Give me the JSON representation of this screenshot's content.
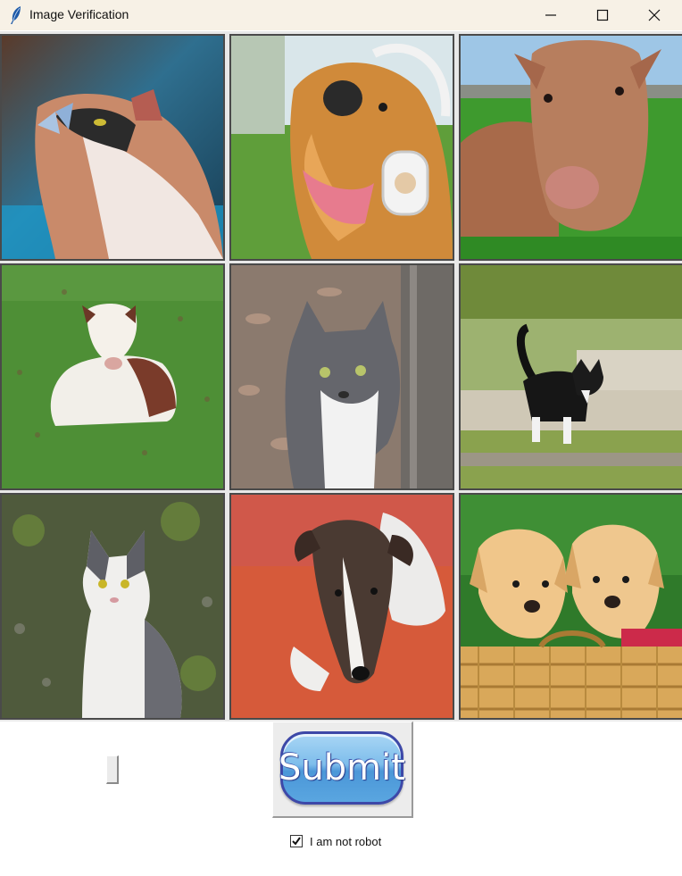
{
  "window": {
    "title": "Image Verification",
    "icons": [
      "feather-icon",
      "minimize-icon",
      "maximize-icon",
      "close-icon"
    ]
  },
  "grid": {
    "tiles": [
      {
        "subject": "cat",
        "icon": "cat-with-butterfly-photo"
      },
      {
        "subject": "dog",
        "icon": "dog-with-headphones-photo"
      },
      {
        "subject": "cow",
        "icon": "calf-lying-in-grass-photo"
      },
      {
        "subject": "cow",
        "icon": "calf-on-lawn-photo"
      },
      {
        "subject": "cat",
        "icon": "gray-cat-by-tree-photo"
      },
      {
        "subject": "cat",
        "icon": "black-cat-walking-photo"
      },
      {
        "subject": "cat",
        "icon": "gray-white-cat-sitting-photo"
      },
      {
        "subject": "dog",
        "icon": "dog-on-red-blanket-photo"
      },
      {
        "subject": "dog",
        "icon": "puppies-in-basket-photo"
      }
    ]
  },
  "controls": {
    "submit_label": "Submit",
    "checkbox_label": "I am not robot",
    "checkbox_checked": true
  },
  "colors": {
    "titlebar": "#f7f1e6",
    "submit_border": "#3d48a8",
    "submit_fill": "#7dbdeb"
  }
}
